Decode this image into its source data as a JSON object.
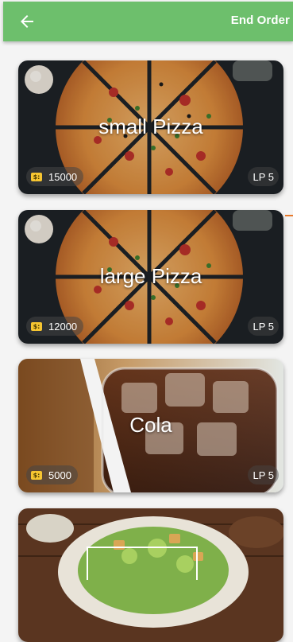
{
  "appbar": {
    "back_icon": "arrow-left-icon",
    "end_order_label": "End Order",
    "color": "#6dbf6c"
  },
  "products": [
    {
      "title": "small Pizza",
      "price": "15000",
      "lp": "LP 5",
      "image": "pizza"
    },
    {
      "title": "large Pizza",
      "price": "12000",
      "lp": "LP 5",
      "image": "pizza"
    },
    {
      "title": "Cola",
      "price": "5000",
      "lp": "LP 5",
      "image": "cola"
    },
    {
      "title": "",
      "price": "",
      "lp": "",
      "image": "salad"
    }
  ],
  "coin_icon": "coin-icon",
  "coin_glyph": "$:"
}
